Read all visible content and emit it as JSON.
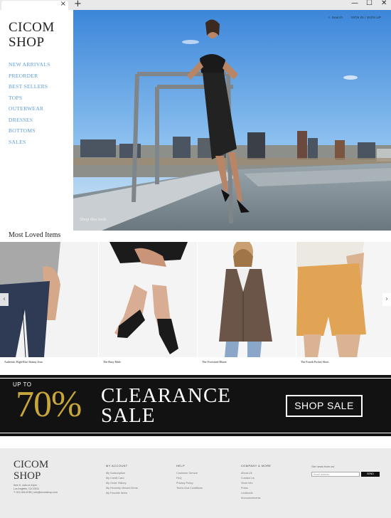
{
  "browser": {
    "tab_close": "×",
    "new_tab": "+",
    "minimize": "—",
    "maximize": "☐",
    "close": "✕"
  },
  "sidebar": {
    "logo_line1": "CICOM",
    "logo_line2": "SHOP",
    "items": [
      {
        "label": "NEW ARRIVALS"
      },
      {
        "label": "PREORDER"
      },
      {
        "label": "BEST SELLERS"
      },
      {
        "label": "TOPS"
      },
      {
        "label": "OUTERWEAR"
      },
      {
        "label": "DRESSES"
      },
      {
        "label": "BOTTOMS"
      },
      {
        "label": "SALES"
      }
    ],
    "link_color": "#5b9bd5"
  },
  "hero": {
    "search": "Search",
    "signin": "SIGN IN / SIGN UP",
    "caption": "Shop this look"
  },
  "section": {
    "title": "Most Loved Items"
  },
  "carousel": {
    "prev": "‹",
    "next": "›",
    "products": [
      {
        "name": "Authentic High-Rise Skinny Jean"
      },
      {
        "name": "The Busy Mule"
      },
      {
        "name": "The Oversized Blazer"
      },
      {
        "name": "The Fourth Pocket Short"
      }
    ]
  },
  "banner": {
    "upto": "UP TO",
    "percent": "70%",
    "line1": "CLEARANCE",
    "line2": "SALE",
    "cta": "SHOP SALE",
    "accent": "#c8a63b"
  },
  "footer": {
    "logo_line1": "CICOM",
    "logo_line2": "SHOP",
    "address": [
      "Item S. cabo st #1pm",
      "Los Angeles, CA 10011",
      "T: 012-345-6789 | info@cicomshop.com"
    ],
    "columns": [
      {
        "heading": "MY ACCOUNT",
        "items": [
          "My Subscription",
          "My Credit Card",
          "My Order History",
          "My Recently Viewed Items",
          "My Favorite Items"
        ]
      },
      {
        "heading": "HELP",
        "items": [
          "Customer Service",
          "FAQ",
          "Privacy Policy",
          "Terms And Conditions"
        ]
      },
      {
        "heading": "COMPANY & MORE",
        "items": [
          "About Us",
          "Contact Us",
          "Store Info",
          "Press",
          "Lookbook",
          "Announcements"
        ]
      }
    ],
    "newsletter": "Get news from us!",
    "email_placeholder": "Email address",
    "send": "SEND"
  }
}
